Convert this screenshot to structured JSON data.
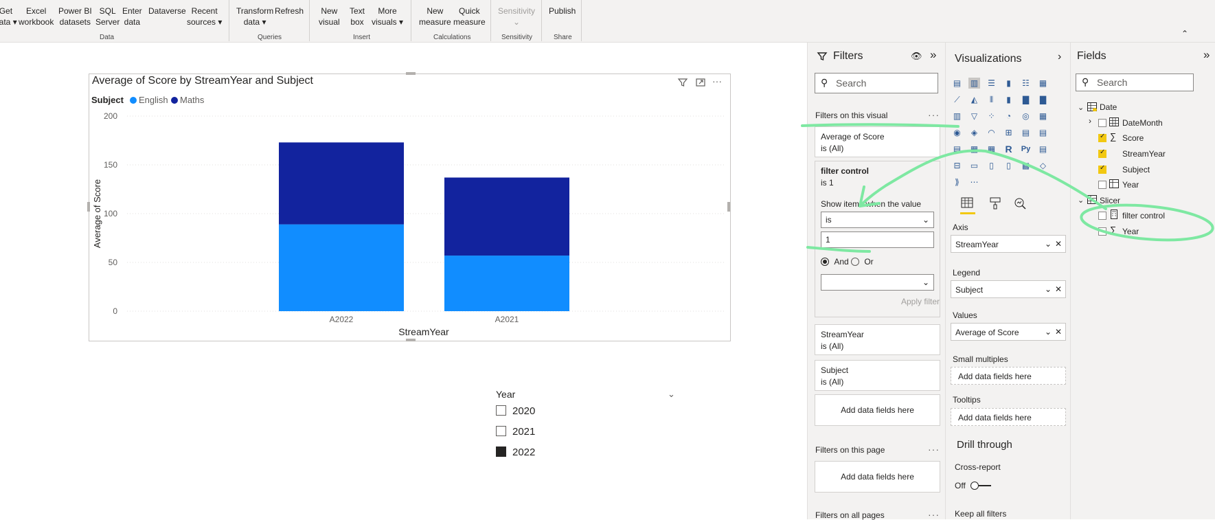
{
  "ribbon": {
    "buttons": [
      {
        "label": "Get\ndata ▾"
      },
      {
        "label": "Excel\nworkbook"
      },
      {
        "label": "Power BI\ndatasets"
      },
      {
        "label": "SQL\nServer"
      },
      {
        "label": "Enter\ndata"
      },
      {
        "label": "Dataverse"
      },
      {
        "label": "Recent\nsources ▾"
      },
      {
        "label": "Transform\ndata ▾"
      },
      {
        "label": "Refresh"
      },
      {
        "label": "New\nvisual"
      },
      {
        "label": "Text\nbox"
      },
      {
        "label": "More\nvisuals ▾"
      },
      {
        "label": "New\nmeasure"
      },
      {
        "label": "Quick\nmeasure"
      },
      {
        "label": "Sensitivity\n⌄"
      },
      {
        "label": "Publish"
      }
    ],
    "groups": [
      "Data",
      "Queries",
      "Insert",
      "Calculations",
      "Sensitivity",
      "Share"
    ],
    "collapse_icon": "chevron-up-icon"
  },
  "visual": {
    "title": "Average of Score by StreamYear and Subject",
    "legend_title": "Subject",
    "icons": [
      "filter-icon",
      "focus-mode-icon",
      "more-options-icon"
    ]
  },
  "chart_data": {
    "type": "bar",
    "stacked": true,
    "title": "Average of Score by StreamYear and Subject",
    "xlabel": "StreamYear",
    "ylabel": "Average of Score",
    "categories": [
      "A2022",
      "A2021"
    ],
    "series": [
      {
        "name": "English",
        "color": "#118dff",
        "values": [
          89,
          57
        ]
      },
      {
        "name": "Maths",
        "color": "#12239e",
        "values": [
          84,
          80
        ]
      }
    ],
    "ylim": [
      0,
      200
    ],
    "yticks": [
      0,
      50,
      100,
      150,
      200
    ],
    "grid": true,
    "legend_position": "top-left"
  },
  "slicer": {
    "title": "Year",
    "items": [
      {
        "label": "2020",
        "checked": false
      },
      {
        "label": "2021",
        "checked": false
      },
      {
        "label": "2022",
        "checked": true
      }
    ]
  },
  "filters": {
    "title": "Filters",
    "search_placeholder": "Search",
    "on_visual_label": "Filters on this visual",
    "cards": [
      {
        "name": "Average of Score",
        "state": "is (All)"
      },
      {
        "name": "StreamYear",
        "state": "is (All)"
      },
      {
        "name": "Subject",
        "state": "is (All)"
      }
    ],
    "expanded": {
      "name": "filter control",
      "state": "is 1",
      "show_items_label": "Show items when the value",
      "operator": "is",
      "value": "1",
      "and_label": "And",
      "or_label": "Or",
      "apply_label": "Apply filter"
    },
    "add_fields": "Add data fields here",
    "on_page_label": "Filters on this page",
    "on_all_pages_label": "Filters on all pages"
  },
  "visualizations": {
    "title": "Visualizations",
    "axis_label": "Axis",
    "axis_value": "StreamYear",
    "legend_label": "Legend",
    "legend_value": "Subject",
    "values_label": "Values",
    "values_value": "Average of Score",
    "small_multiples_label": "Small multiples",
    "tooltips_label": "Tooltips",
    "add_fields": "Add data fields here",
    "drill_through": "Drill through",
    "cross_report": "Cross-report",
    "off_label": "Off",
    "keep_all_filters": "Keep all filters"
  },
  "fields": {
    "title": "Fields",
    "search_placeholder": "Search",
    "tables": [
      {
        "name": "Date",
        "items": [
          {
            "name": "DateMonth",
            "checked": false
          },
          {
            "name": "Score",
            "checked": true
          },
          {
            "name": "StreamYear",
            "checked": true
          },
          {
            "name": "Subject",
            "checked": true
          },
          {
            "name": "Year",
            "checked": false
          }
        ]
      },
      {
        "name": "Slicer",
        "items": [
          {
            "name": "filter control",
            "checked": false
          },
          {
            "name": "Year",
            "checked": false
          }
        ]
      }
    ]
  },
  "colors": {
    "annotation": "#7ee8a2",
    "english": "#118dff",
    "maths": "#12239e"
  }
}
